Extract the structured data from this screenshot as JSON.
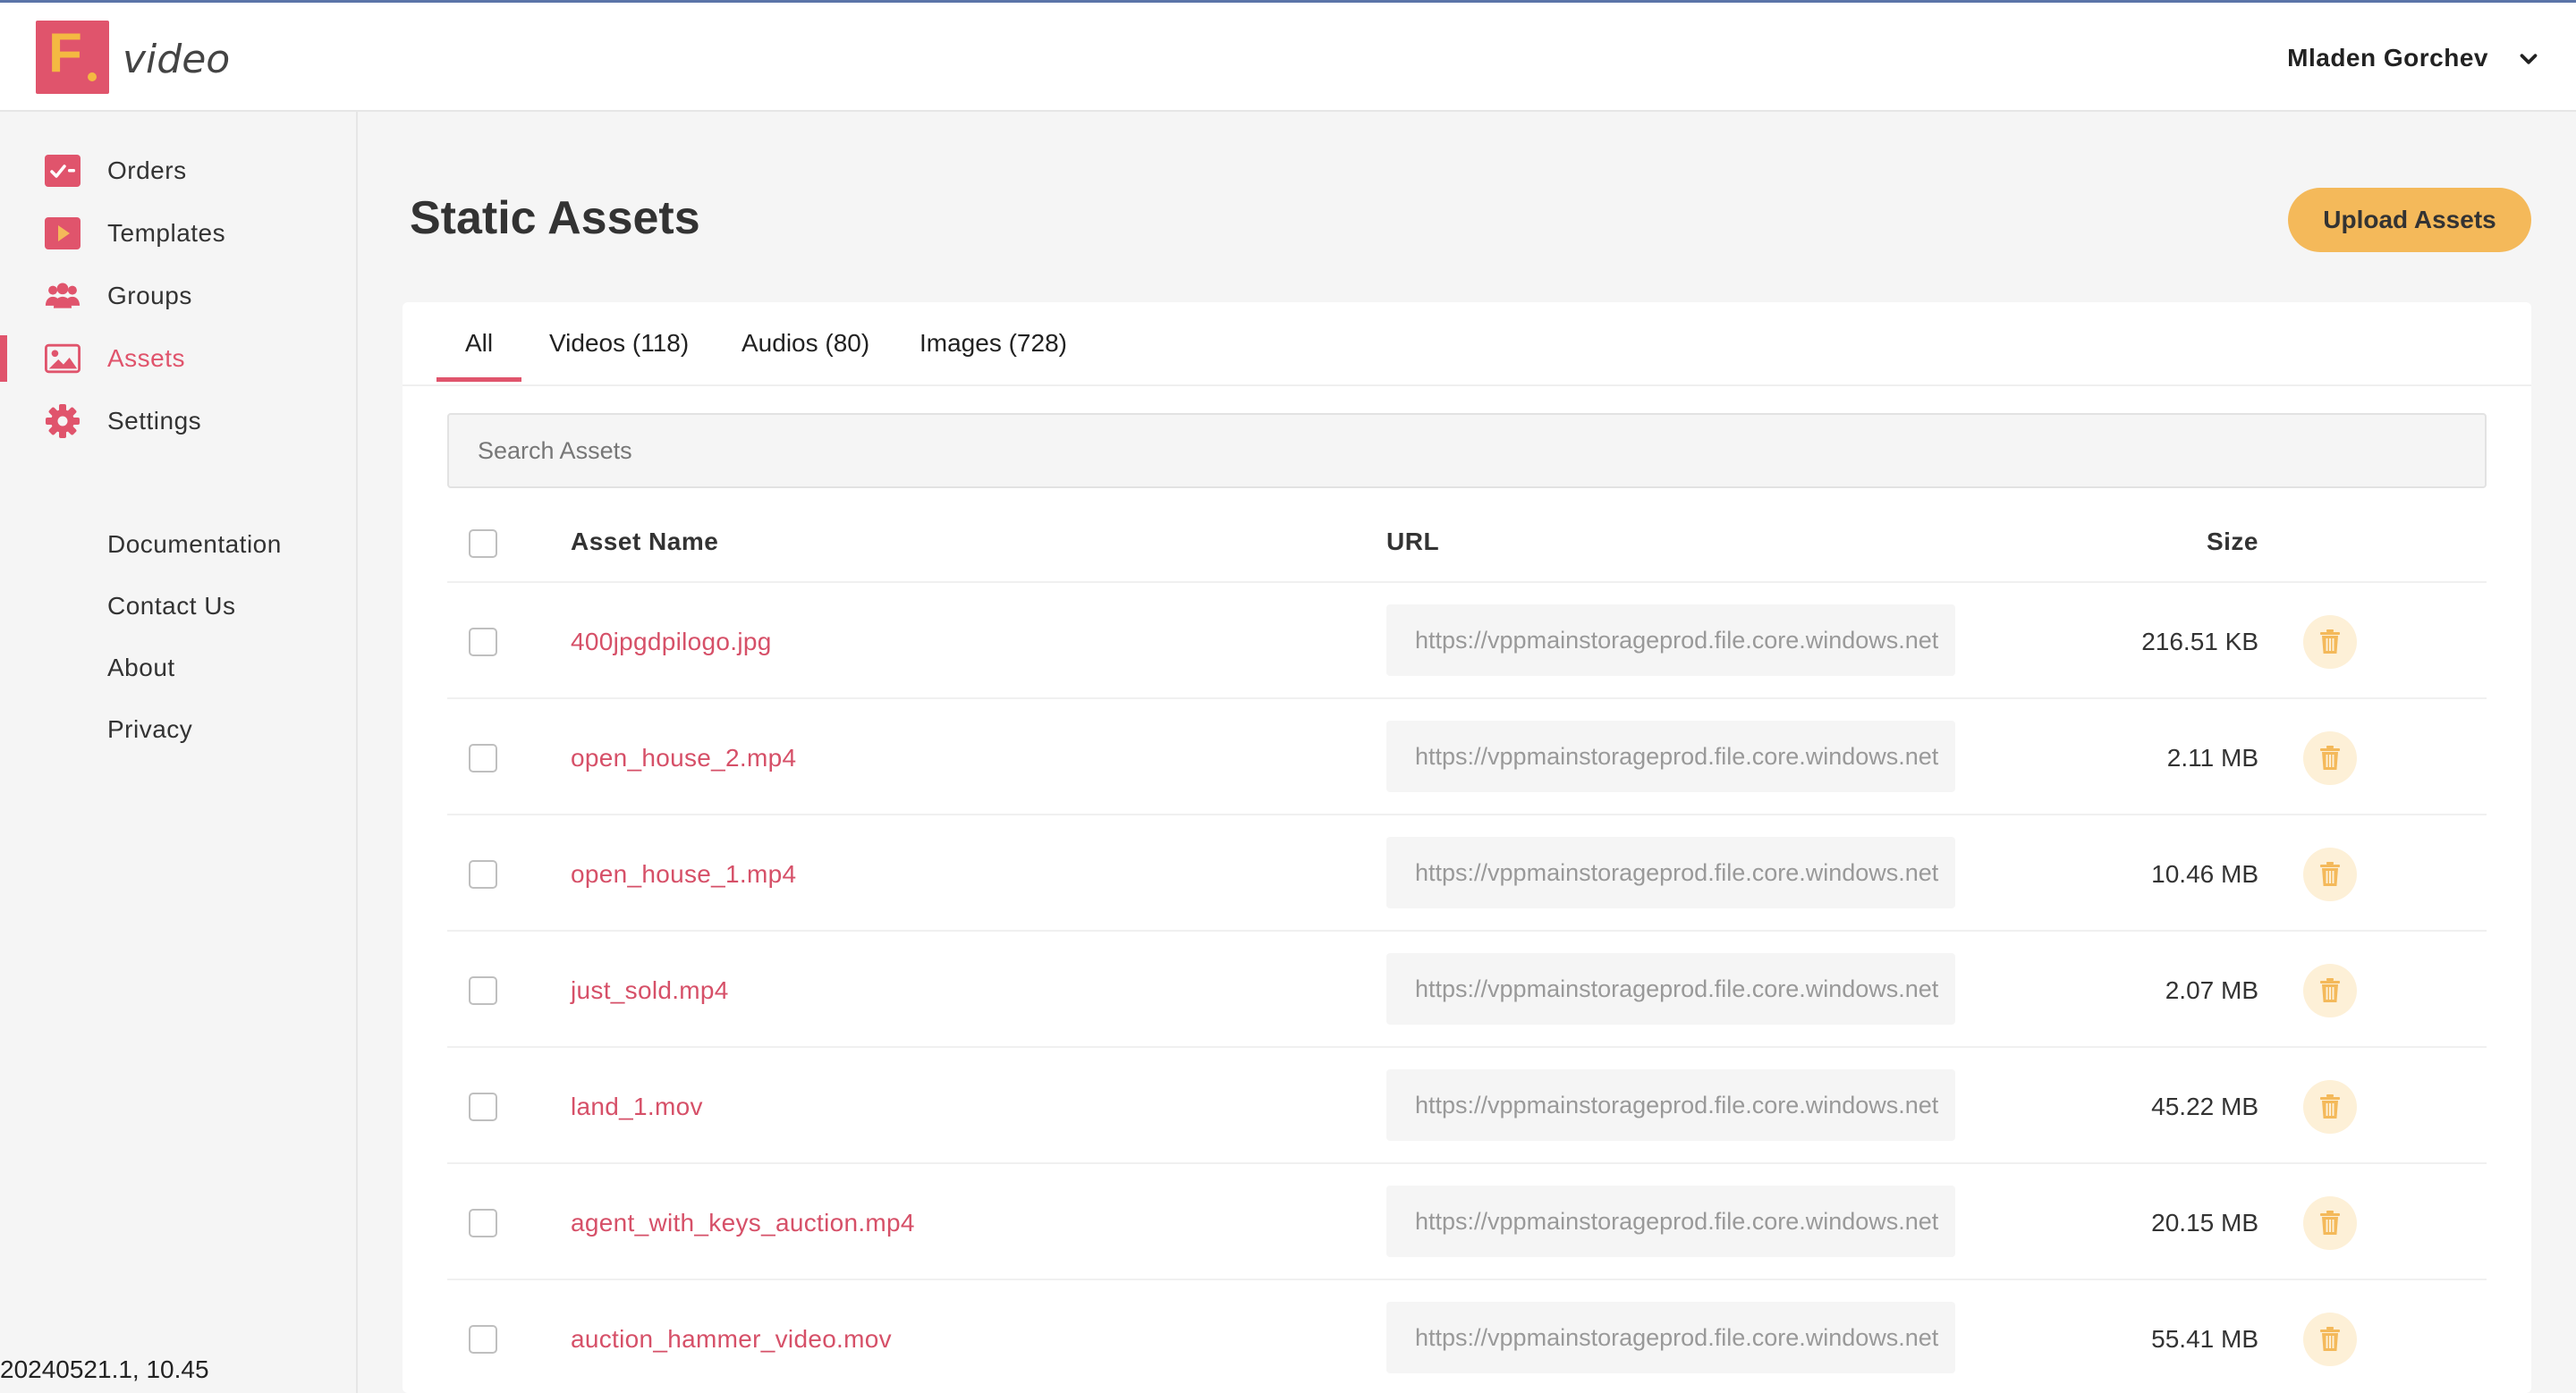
{
  "app": {
    "logo_letter": "F",
    "logo_text": "video",
    "user_name": "Mladen Gorchev"
  },
  "colors": {
    "brand": "#e0546c",
    "accent": "#f4b95a",
    "link": "#d65068"
  },
  "sidebar": {
    "items": [
      {
        "label": "Orders",
        "icon": "orders-check-icon"
      },
      {
        "label": "Templates",
        "icon": "play-icon"
      },
      {
        "label": "Groups",
        "icon": "users-icon"
      },
      {
        "label": "Assets",
        "icon": "image-icon",
        "active": true
      },
      {
        "label": "Settings",
        "icon": "gear-icon"
      }
    ],
    "links": [
      "Documentation",
      "Contact Us",
      "About",
      "Privacy"
    ],
    "version": "20240521.1, 10.45"
  },
  "main": {
    "title": "Static Assets",
    "upload_label": "Upload Assets",
    "tabs": [
      "All",
      "Videos (118)",
      "Audios (80)",
      "Images (728)"
    ],
    "active_tab": "All",
    "search_placeholder": "Search Assets",
    "columns": {
      "name": "Asset Name",
      "url": "URL",
      "size": "Size"
    },
    "rows": [
      {
        "name": "400jpgdpilogo.jpg",
        "url": "https://vppmainstorageprod.file.core.windows.net",
        "size": "216.51 KB"
      },
      {
        "name": "open_house_2.mp4",
        "url": "https://vppmainstorageprod.file.core.windows.net",
        "size": "2.11 MB"
      },
      {
        "name": "open_house_1.mp4",
        "url": "https://vppmainstorageprod.file.core.windows.net",
        "size": "10.46 MB"
      },
      {
        "name": "just_sold.mp4",
        "url": "https://vppmainstorageprod.file.core.windows.net",
        "size": "2.07 MB"
      },
      {
        "name": "land_1.mov",
        "url": "https://vppmainstorageprod.file.core.windows.net",
        "size": "45.22 MB"
      },
      {
        "name": "agent_with_keys_auction.mp4",
        "url": "https://vppmainstorageprod.file.core.windows.net",
        "size": "20.15 MB"
      },
      {
        "name": "auction_hammer_video.mov",
        "url": "https://vppmainstorageprod.file.core.windows.net",
        "size": "55.41 MB"
      }
    ]
  }
}
